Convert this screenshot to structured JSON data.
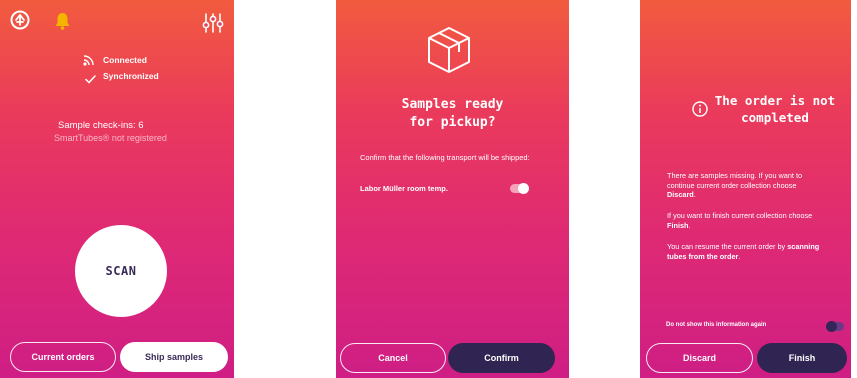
{
  "screen1": {
    "status": {
      "connected": "Connected",
      "synchronized": "Synchronized"
    },
    "checkins": "Sample check-ins: 6",
    "smarttubes": "SmartTubes® not registered",
    "scan_label": "SCAN",
    "buttons": {
      "current_orders": "Current orders",
      "ship_samples": "Ship samples"
    }
  },
  "screen2": {
    "title_line1": "Samples ready",
    "title_line2": "for pickup?",
    "description": "Confirm that the following transport will be shipped:",
    "transport": "Labor Müller room temp.",
    "buttons": {
      "cancel": "Cancel",
      "confirm": "Confirm"
    }
  },
  "screen3": {
    "title_line1": "The order is not",
    "title_line2": "completed",
    "p1_text": "There are samples missing. If you want to continue current order collection choose ",
    "p1_bold": "Discard",
    "p1_end": ".",
    "p2_text": "If you want to finish current collection choose ",
    "p2_bold": "Finish",
    "p2_end": ".",
    "p3_text": "You can resume the current order by ",
    "p3_bold": "scanning tubes from the order",
    "p3_end": ".",
    "do_not_show": "Do not show this information again",
    "buttons": {
      "discard": "Discard",
      "finish": "Finish"
    }
  },
  "colors": {
    "gradient_top": "#f25b3e",
    "gradient_bottom": "#cf1e85",
    "dark_button": "#302552",
    "bell": "#f5b400"
  },
  "icons": [
    "app-logo-icon",
    "bell-icon",
    "settings-sliders-icon",
    "connection-icon",
    "check-icon",
    "box-icon",
    "info-icon"
  ]
}
